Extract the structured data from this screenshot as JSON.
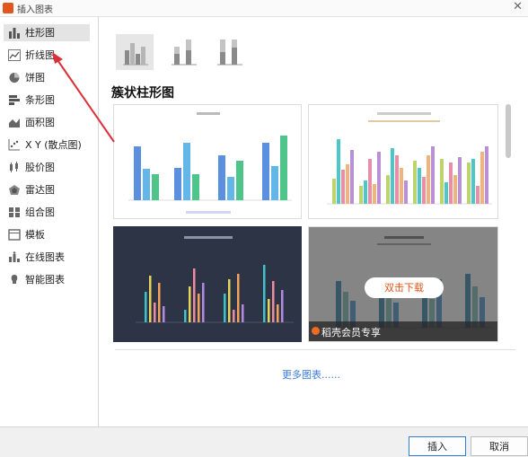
{
  "window": {
    "title": "插入图表",
    "close_glyph": "✕"
  },
  "sidebar": {
    "items": [
      {
        "label": "柱形图",
        "icon": "column-chart-icon",
        "active": true
      },
      {
        "label": "折线图",
        "icon": "line-chart-icon"
      },
      {
        "label": "饼图",
        "icon": "pie-chart-icon"
      },
      {
        "label": "条形图",
        "icon": "bar-chart-icon"
      },
      {
        "label": "面积图",
        "icon": "area-chart-icon"
      },
      {
        "label": "X Y (散点图)",
        "icon": "scatter-chart-icon"
      },
      {
        "label": "股价图",
        "icon": "stock-chart-icon"
      },
      {
        "label": "雷达图",
        "icon": "radar-chart-icon"
      },
      {
        "label": "组合图",
        "icon": "combo-chart-icon"
      },
      {
        "label": "模板",
        "icon": "template-icon"
      },
      {
        "label": "在线图表",
        "icon": "online-chart-icon"
      },
      {
        "label": "智能图表",
        "icon": "smart-chart-icon"
      }
    ]
  },
  "main": {
    "subtypes": [
      "clustered-column",
      "stacked-column",
      "percent-stacked-column"
    ],
    "section_title": "簇状柱形图",
    "member_badge": "稻壳会员专享",
    "download_button": "双击下载",
    "more_link": "更多图表......"
  },
  "footer": {
    "insert_label": "插入",
    "cancel_label": "取消"
  },
  "colors": {
    "accent": "#2f7fd6",
    "annotation": "#d9303a",
    "member_orange": "#f06a24",
    "link": "#3b7bd6"
  }
}
